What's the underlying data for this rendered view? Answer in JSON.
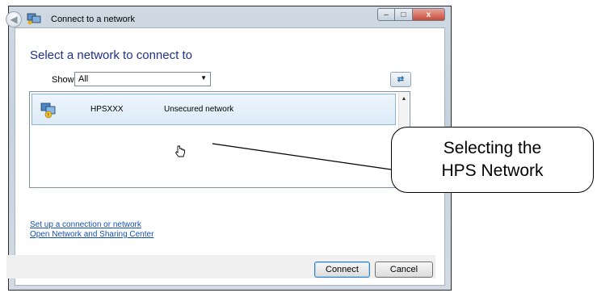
{
  "window": {
    "header_title": "Connect to a network",
    "caption": {
      "min": "–",
      "max": "□",
      "close": "x"
    }
  },
  "main": {
    "title": "Select a network to connect to",
    "show_label": "Show",
    "show_value": "All"
  },
  "networks": [
    {
      "name": "HPSXXX",
      "status": "Unsecured network"
    }
  ],
  "links": {
    "setup": "Set up a connection or network",
    "sharing": "Open Network and Sharing Center"
  },
  "buttons": {
    "connect": "Connect",
    "cancel": "Cancel"
  },
  "callout": {
    "line1": "Selecting the",
    "line2": "HPS Network"
  }
}
